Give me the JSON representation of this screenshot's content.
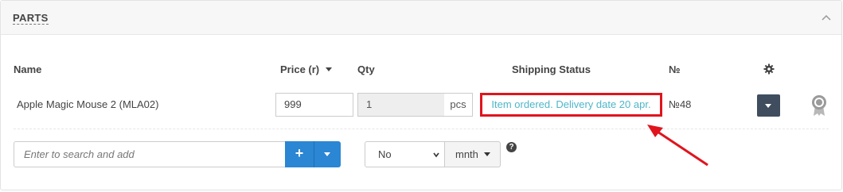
{
  "panel": {
    "title": "PARTS"
  },
  "table": {
    "headers": {
      "name": "Name",
      "price": "Price (r)",
      "qty": "Qty",
      "shipping": "Shipping Status",
      "number": "№"
    },
    "row": {
      "name": "Apple Magic Mouse 2 (MLA02)",
      "price": "999",
      "qty": "1",
      "unit": "pcs",
      "shipping_status": "Item ordered. Delivery date 20 apr.",
      "number": "№48"
    }
  },
  "add": {
    "search_placeholder": "Enter to search and add",
    "plus_label": "+"
  },
  "warranty": {
    "select_value": "No",
    "period_label": "mnth"
  },
  "help_label": "?",
  "colors": {
    "status_text": "#4fb6c9",
    "highlight": "#e0141e",
    "primary": "#2b86d3",
    "dark_button": "#3f4d5e"
  },
  "icons": [
    "chevron-up-icon",
    "sort-caret-icon",
    "gear-icon",
    "award-icon",
    "plus-icon",
    "caret-down-icon",
    "question-icon",
    "arrow-annotation"
  ]
}
